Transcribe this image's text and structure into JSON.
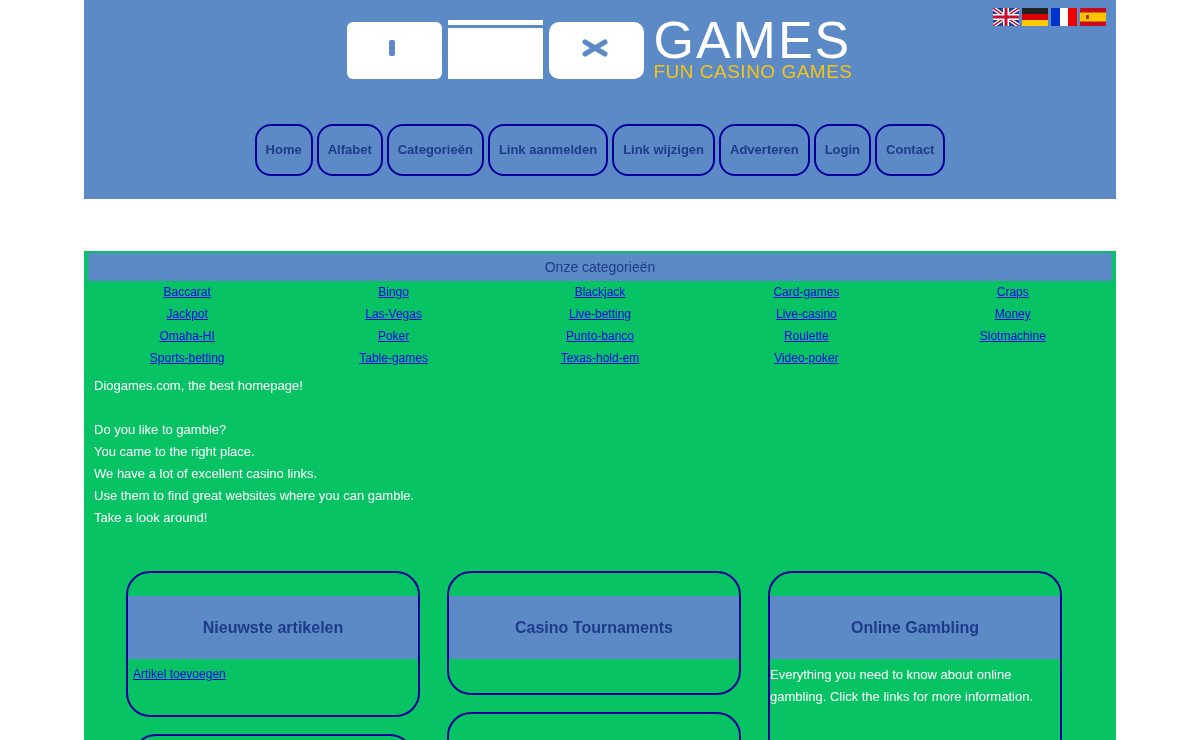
{
  "logo": {
    "title": "GAMES",
    "tagline": "FUN CASINO GAMES"
  },
  "nav": [
    "Home",
    "Alfabet",
    "Categorieën",
    "Link aanmelden",
    "Link wijzigen",
    "Adverteren",
    "Login",
    "Contact"
  ],
  "categories": {
    "title": "Onze categorieën",
    "links": [
      "Baccarat",
      "Bingo",
      "Blackjack",
      "Card-games",
      "Craps",
      "Jackpot",
      "Las-Vegas",
      "Live-betting",
      "Live-casino",
      "Money",
      "Omaha-HI",
      "Poker",
      "Punto-banco",
      "Roulette",
      "Slotmachine",
      "Sports-betting",
      "Table-games",
      "Texas-hold-em",
      "Video-poker"
    ]
  },
  "intro": {
    "heading": "Diogames.com, the best homepage!",
    "lines": [
      "Do you like to gamble?",
      "You came to the right place.",
      "We have a lot of excellent casino links.",
      "Use them to find great websites where you can gamble.",
      "Take a look around!"
    ]
  },
  "cards": [
    {
      "title": "Nieuwste artikelen",
      "link": "Artikel toevoegen"
    },
    {
      "title": "Casino Tournaments"
    },
    {
      "title": "Online Gambling",
      "text": "Everything you need to know about online gambling. Click the links for more information."
    }
  ]
}
